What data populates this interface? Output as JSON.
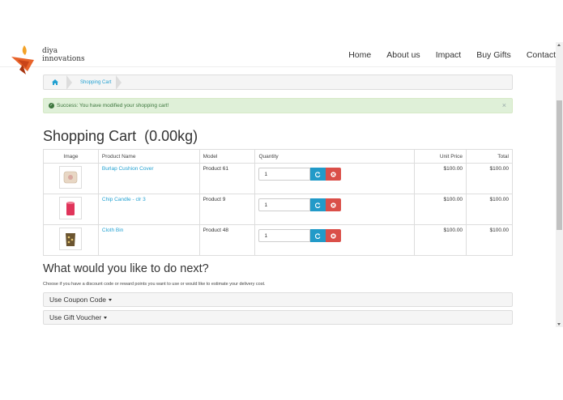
{
  "brand": {
    "line1": "diya",
    "line2": "innovations"
  },
  "nav": [
    "Home",
    "About us",
    "Impact",
    "Buy Gifts",
    "Contact"
  ],
  "breadcrumb": {
    "home_icon": "home-icon",
    "current": "Shopping Cart"
  },
  "alert": {
    "icon": "check-circle-icon",
    "text": "Success: You have modified your shopping cart!",
    "close": "×"
  },
  "page_title": "Shopping Cart  (0.00kg)",
  "table": {
    "headers": {
      "image": "Image",
      "name": "Product Name",
      "model": "Model",
      "quantity": "Quantity",
      "unit_price": "Unit Price",
      "total": "Total"
    },
    "rows": [
      {
        "name": "Burlap Cushion Cover",
        "model": "Product 61",
        "qty": "1",
        "unit_price": "$100.00",
        "total": "$100.00",
        "thumb_color": "#e8d7c4"
      },
      {
        "name": "Chip Candle - clr 3",
        "model": "Product 9",
        "qty": "1",
        "unit_price": "$100.00",
        "total": "$100.00",
        "thumb_color": "#e0345a"
      },
      {
        "name": "Cloth Bin",
        "model": "Product 48",
        "qty": "1",
        "unit_price": "$100.00",
        "total": "$100.00",
        "thumb_color": "#6b5530"
      }
    ]
  },
  "next": {
    "title": "What would you like to do next?",
    "description": "Choose if you have a discount code or reward points you want to use or would like to estimate your delivery cost.",
    "panels": [
      "Use Coupon Code",
      "Use Gift Voucher"
    ]
  },
  "colors": {
    "link": "#23a1d1",
    "update_button": "#229ac8",
    "remove_button": "#da4f49",
    "success_bg": "#dff0d8",
    "logo_accent": "#e8632a"
  }
}
